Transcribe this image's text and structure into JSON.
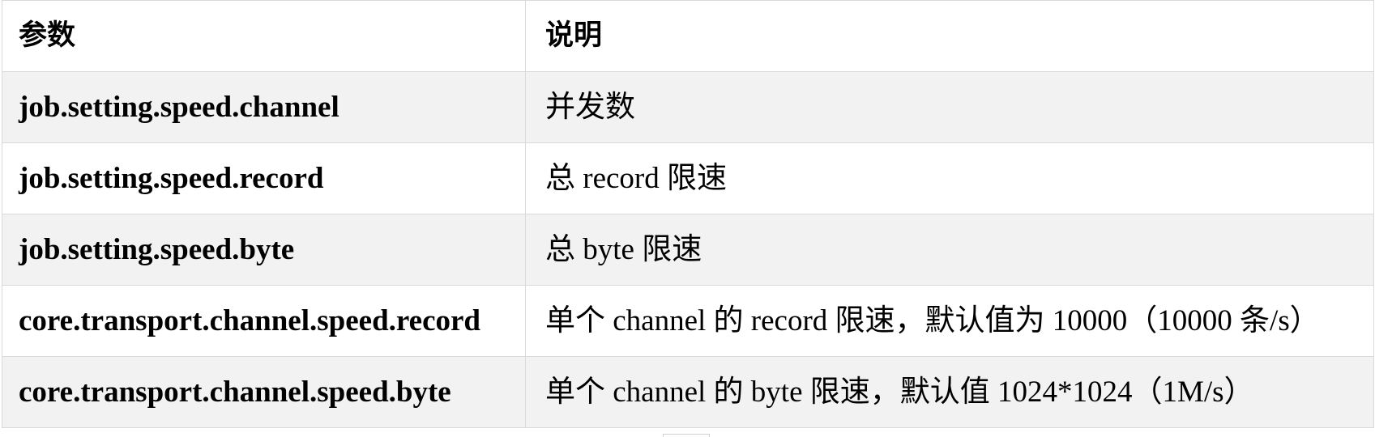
{
  "table": {
    "headers": {
      "param": "参数",
      "description": "说明"
    },
    "rows": [
      {
        "param": "job.setting.speed.channel",
        "description": "并发数"
      },
      {
        "param": "job.setting.speed.record",
        "description": "总 record 限速"
      },
      {
        "param": "job.setting.speed.byte",
        "description": "总 byte 限速"
      },
      {
        "param": "core.transport.channel.speed.record",
        "description": "单个 channel 的 record 限速，默认值为 10000（10000 条/s）"
      },
      {
        "param": "core.transport.channel.speed.byte",
        "description": "单个 channel 的 byte 限速，默认值 1024*1024（1M/s）"
      }
    ]
  },
  "colors": {
    "shaded_row": "#f2f2f2",
    "border": "#d9d9d9",
    "text": "#000000"
  }
}
